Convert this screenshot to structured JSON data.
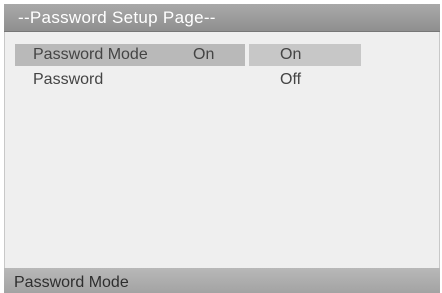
{
  "title_bar": {
    "text": "--Password Setup Page--"
  },
  "settings": {
    "rows": [
      {
        "label": "Password Mode",
        "value": "On"
      },
      {
        "label": "Password",
        "value": ""
      }
    ]
  },
  "options": {
    "items": [
      "On",
      "Off"
    ],
    "selected": "On"
  },
  "status_bar": {
    "text": "Password Mode"
  }
}
